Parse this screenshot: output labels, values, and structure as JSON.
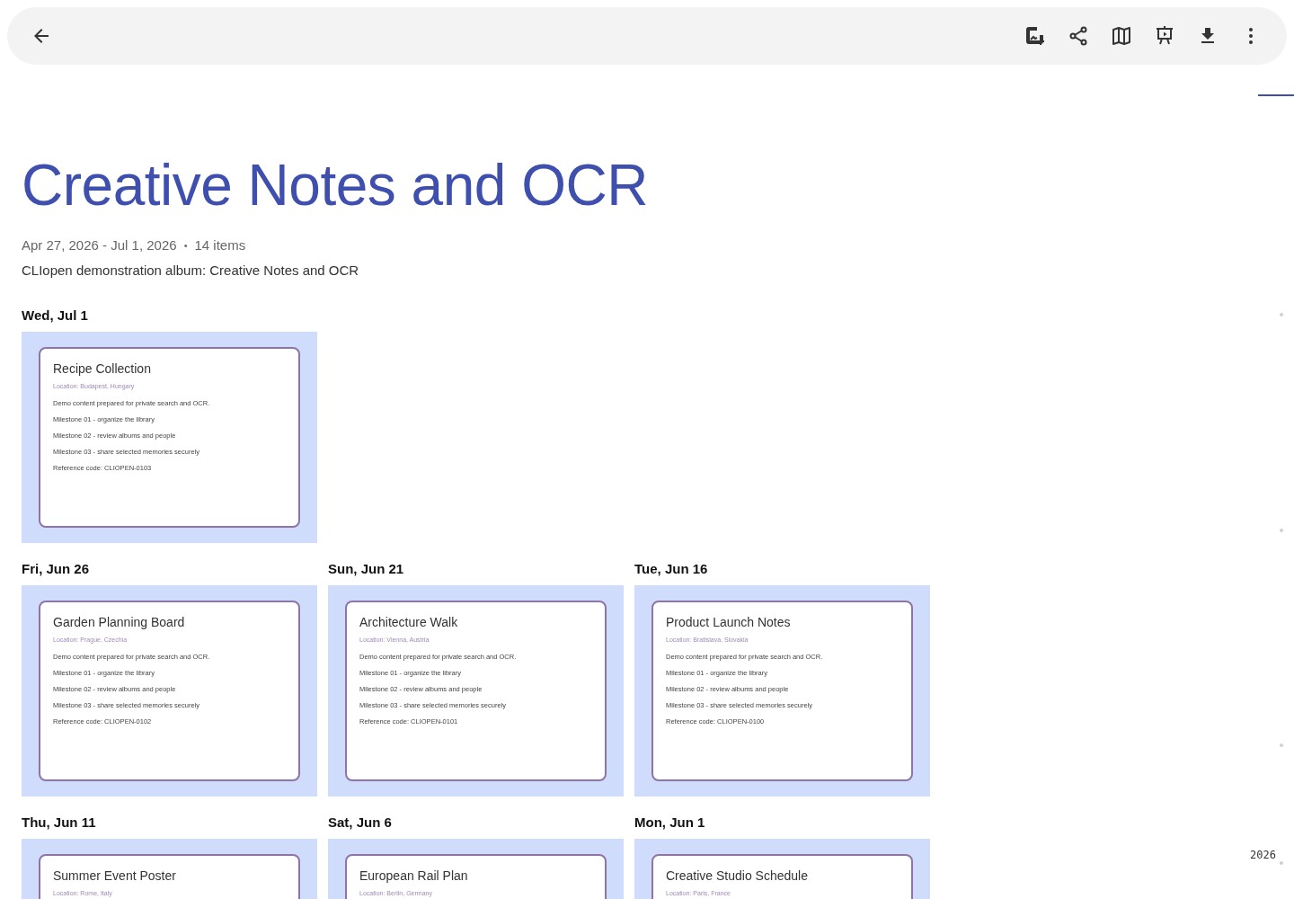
{
  "album": {
    "title": "Creative Notes and OCR",
    "date_range": "Apr 27, 2026 - Jul 1, 2026",
    "separator": "•",
    "count": "14 items",
    "description": "CLIopen demonstration album: Creative Notes and OCR"
  },
  "sections": [
    {
      "date": "Wed, Jul 1",
      "items": [
        {
          "title": "Recipe Collection",
          "location": "Location: Budapest, Hungary",
          "lines": [
            "Demo content prepared for private search and OCR.",
            "Milestone 01 - organize the library",
            "Milestone 02 - review albums and people",
            "Milestone 03 - share selected memories securely",
            "Reference code: CLIOPEN-0103"
          ]
        }
      ]
    },
    {
      "date": "Fri, Jun 26",
      "items": [
        {
          "title": "Garden Planning Board",
          "location": "Location: Prague, Czechia",
          "lines": [
            "Demo content prepared for private search and OCR.",
            "Milestone 01 - organize the library",
            "Milestone 02 - review albums and people",
            "Milestone 03 - share selected memories securely",
            "Reference code: CLIOPEN-0102"
          ]
        }
      ]
    },
    {
      "date": "Sun, Jun 21",
      "items": [
        {
          "title": "Architecture Walk",
          "location": "Location: Vienna, Austria",
          "lines": [
            "Demo content prepared for private search and OCR.",
            "Milestone 01 - organize the library",
            "Milestone 02 - review albums and people",
            "Milestone 03 - share selected memories securely",
            "Reference code: CLIOPEN-0101"
          ]
        }
      ]
    },
    {
      "date": "Tue, Jun 16",
      "items": [
        {
          "title": "Product Launch Notes",
          "location": "Location: Bratislava, Slovakia",
          "lines": [
            "Demo content prepared for private search and OCR.",
            "Milestone 01 - organize the library",
            "Milestone 02 - review albums and people",
            "Milestone 03 - share selected memories securely",
            "Reference code: CLIOPEN-0100"
          ]
        }
      ]
    },
    {
      "date": "Thu, Jun 11",
      "items": [
        {
          "title": "Summer Event Poster",
          "location": "Location: Rome, Italy"
        }
      ]
    },
    {
      "date": "Sat, Jun 6",
      "items": [
        {
          "title": "European Rail Plan",
          "location": "Location: Berlin, Germany"
        }
      ]
    },
    {
      "date": "Mon, Jun 1",
      "items": [
        {
          "title": "Creative Studio Schedule",
          "location": "Location: Paris, France"
        }
      ]
    }
  ],
  "scrubber": {
    "year": "2026"
  }
}
